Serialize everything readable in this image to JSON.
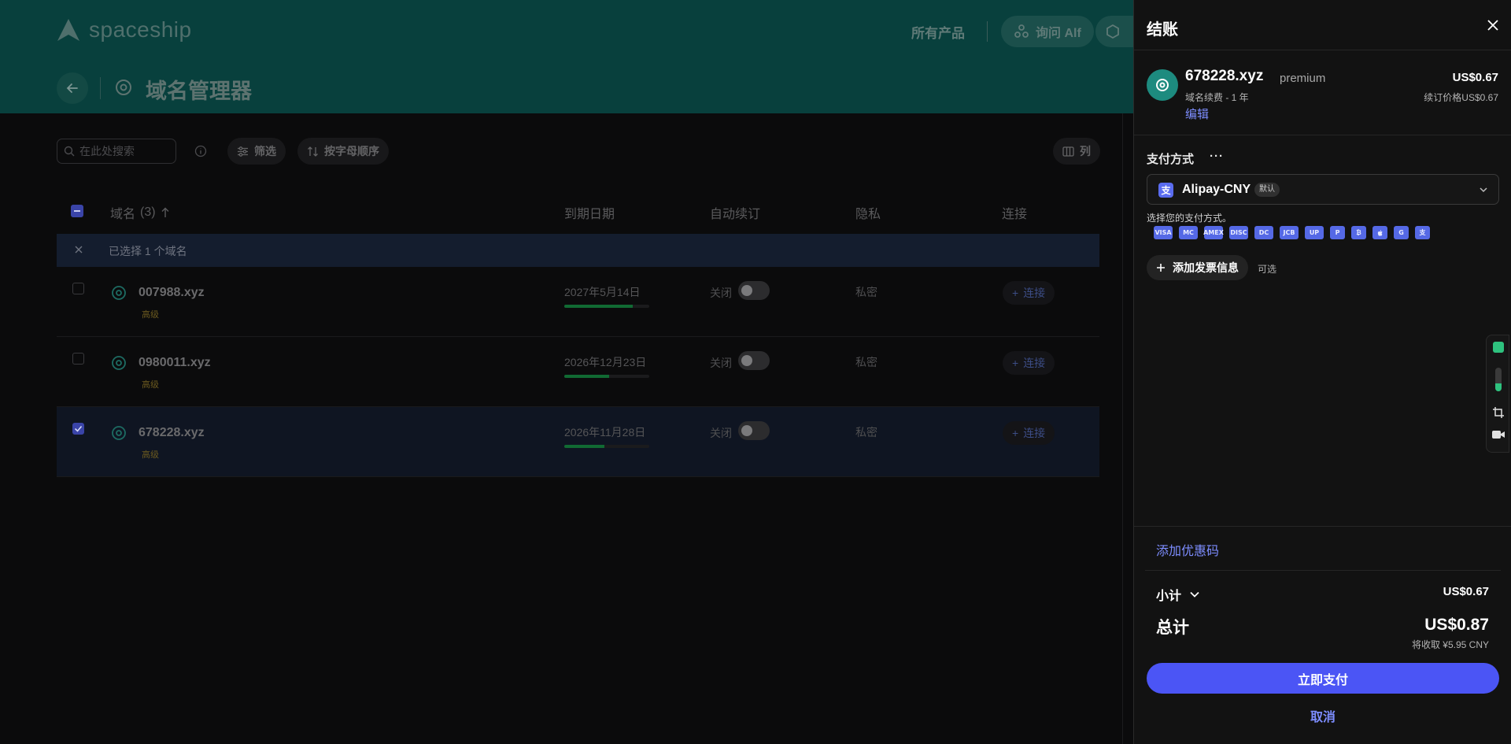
{
  "header": {
    "logo_text": "spaceship",
    "nav_all_products": "所有产品",
    "ask_alf": "询问 Alf",
    "page_title": "域名管理器"
  },
  "toolbar": {
    "search_placeholder": "在此处搜索",
    "filter_label": "筛选",
    "sort_label": "按字母顺序",
    "columns_label": "列"
  },
  "table": {
    "headers": {
      "domain": "域名",
      "count": "(3)",
      "expiry": "到期日期",
      "auto_renew": "自动续订",
      "privacy": "隐私",
      "connect": "连接"
    },
    "selection_text": "已选择 1 个域名",
    "rows": [
      {
        "name": "007988.xyz",
        "tag": "高级",
        "date": "2027年5月14日",
        "progress": 0.81,
        "auto_renew": "关闭",
        "privacy": "私密",
        "connect": "连接",
        "checked": false
      },
      {
        "name": "0980011.xyz",
        "tag": "高级",
        "date": "2026年12月23日",
        "progress": 0.53,
        "auto_renew": "关闭",
        "privacy": "私密",
        "connect": "连接",
        "checked": false
      },
      {
        "name": "678228.xyz",
        "tag": "高级",
        "date": "2026年11月28日",
        "progress": 0.47,
        "auto_renew": "关闭",
        "privacy": "私密",
        "connect": "连接",
        "checked": true
      }
    ]
  },
  "checkout": {
    "title": "结账",
    "item": {
      "name": "678228.xyz",
      "tier": "premium",
      "subtitle": "域名续费 - 1 年",
      "edit": "编辑",
      "price": "US$0.67",
      "renewal": "续订价格US$0.67"
    },
    "payment": {
      "label": "支付方式",
      "more": "···",
      "selected": "Alipay-CNY",
      "default_badge": "默认",
      "hint": "选择您的支付方式。",
      "icons": [
        "VISA",
        "MC",
        "AMEX",
        "DISC",
        "DC",
        "JCB",
        "UP",
        "P",
        "₿",
        "",
        "G",
        "支"
      ]
    },
    "invoice_button": "添加发票信息",
    "invoice_optional": "可选",
    "coupon": "添加优惠码",
    "subtotal_label": "小计",
    "subtotal_value": "US$0.67",
    "total_label": "总计",
    "total_value": "US$0.87",
    "total_cny": "将收取 ¥5.95 CNY",
    "pay_button": "立即支付",
    "cancel": "取消"
  },
  "widget": {
    "level": 0.35
  },
  "colors": {
    "teal_header": "#08403d",
    "accent": "#4b55f5",
    "link": "#7d8dff",
    "green": "#2ec27e"
  }
}
